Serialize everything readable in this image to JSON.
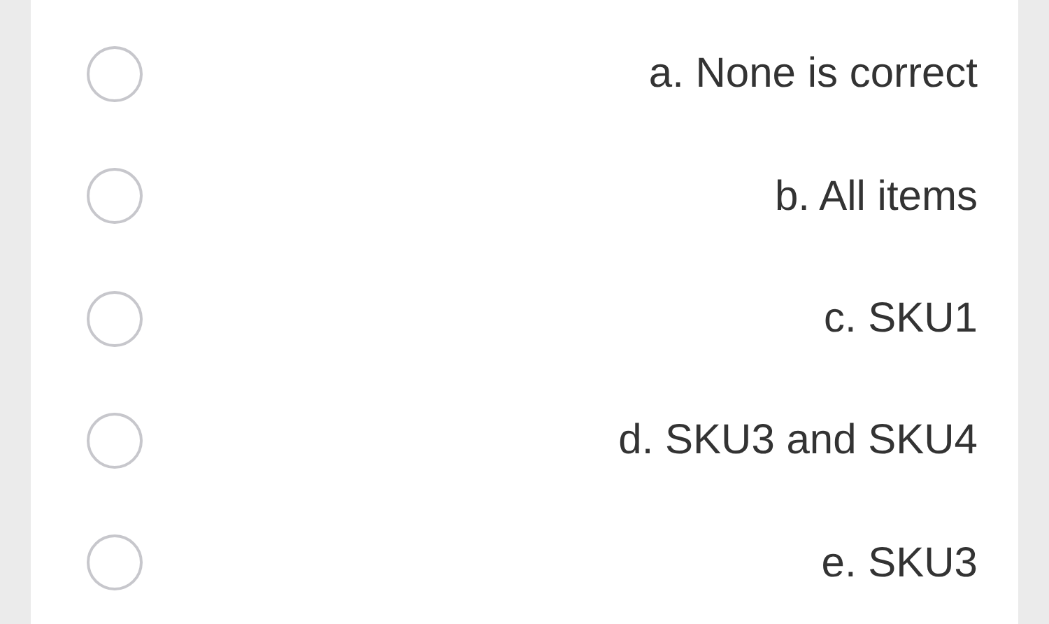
{
  "options": [
    {
      "label": "a. None is correct",
      "selected": false
    },
    {
      "label": "b. All items",
      "selected": false
    },
    {
      "label": "c. SKU1",
      "selected": false
    },
    {
      "label": "d. SKU3 and SKU4",
      "selected": false
    },
    {
      "label": "e. SKU3",
      "selected": false
    }
  ]
}
